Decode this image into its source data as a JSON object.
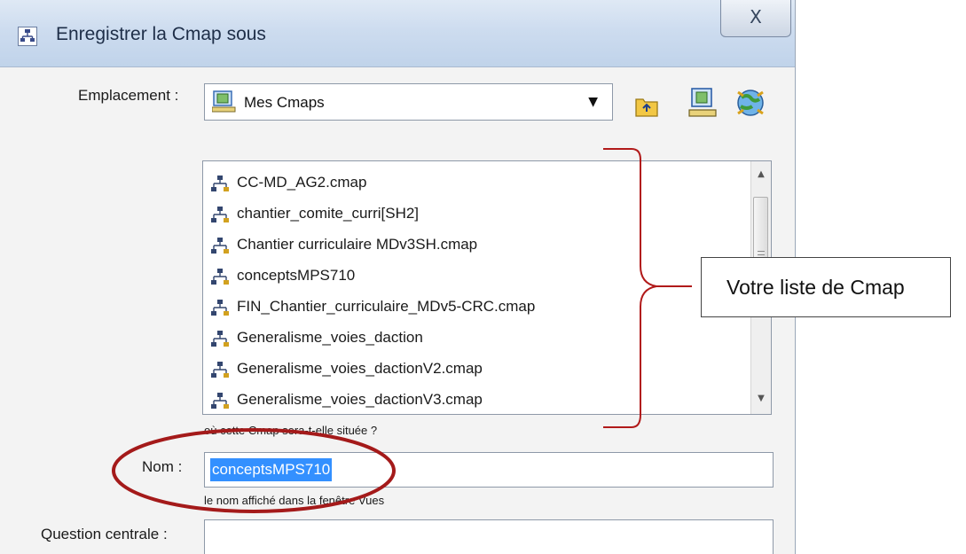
{
  "window": {
    "title": "Enregistrer la Cmap sous",
    "close_glyph": "X"
  },
  "location": {
    "label": "Emplacement :",
    "value": "Mes Cmaps",
    "icons": [
      "folder-up-icon",
      "computer-icon",
      "network-globe-icon"
    ]
  },
  "file_list": {
    "items": [
      "CC-MD_AG2.cmap",
      "chantier_comite_curri[SH2]",
      "Chantier curriculaire MDv3SH.cmap",
      "conceptsMPS710",
      "FIN_Chantier_curriculaire_MDv5-CRC.cmap",
      "Generalisme_voies_daction",
      "Generalisme_voies_dactionV2.cmap",
      "Generalisme_voies_dactionV3.cmap"
    ],
    "hint": "où cette Cmap sera-t-elle située ?"
  },
  "name": {
    "label": "Nom :",
    "value": "conceptsMPS710",
    "hint": "le nom affiché dans la fenêtre Vues"
  },
  "question": {
    "label": "Question centrale :",
    "value": ""
  },
  "annotation": {
    "callout_text": "Votre liste de Cmap",
    "accent": "#b11a1a"
  }
}
